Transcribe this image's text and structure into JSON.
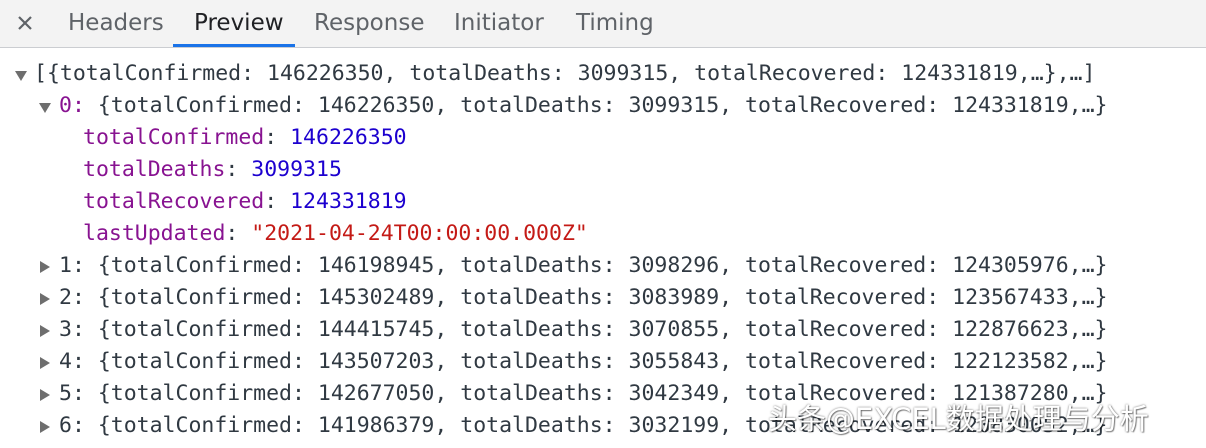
{
  "tabs": {
    "close_icon": "close-icon",
    "items": [
      {
        "label": "Headers"
      },
      {
        "label": "Preview"
      },
      {
        "label": "Response"
      },
      {
        "label": "Initiator"
      },
      {
        "label": "Timing"
      }
    ],
    "active": "Preview",
    "accent_color": "#1a73e8"
  },
  "preview": {
    "root_summary": "[{totalConfirmed: 146226350, totalDeaths: 3099315, totalRecovered: 124331819,…},…]",
    "expanded_item": {
      "index_label": "0:",
      "summary": " {totalConfirmed: 146226350, totalDeaths: 3099315, totalRecovered: 124331819,…}",
      "props": [
        {
          "key": "totalConfirmed",
          "sep": ": ",
          "value": "146226350",
          "type": "num"
        },
        {
          "key": "totalDeaths",
          "sep": ": ",
          "value": "3099315",
          "type": "num"
        },
        {
          "key": "totalRecovered",
          "sep": ": ",
          "value": "124331819",
          "type": "num"
        },
        {
          "key": "lastUpdated",
          "sep": ": ",
          "value": "\"2021-04-24T00:00:00.000Z\"",
          "type": "str"
        }
      ]
    },
    "collapsed_items": [
      {
        "label": "1: {totalConfirmed: 146198945, totalDeaths: 3098296, totalRecovered: 124305976,…}"
      },
      {
        "label": "2: {totalConfirmed: 145302489, totalDeaths: 3083989, totalRecovered: 123567433,…}"
      },
      {
        "label": "3: {totalConfirmed: 144415745, totalDeaths: 3070855, totalRecovered: 122876623,…}"
      },
      {
        "label": "4: {totalConfirmed: 143507203, totalDeaths: 3055843, totalRecovered: 122123582,…}"
      },
      {
        "label": "5: {totalConfirmed: 142677050, totalDeaths: 3042349, totalRecovered: 121387280,…}"
      },
      {
        "label": "6: {totalConfirmed: 141986379, totalDeaths: 3032199, totalRecovered: 120830052,…}"
      }
    ],
    "colors": {
      "key": "#881391",
      "number": "#1c00cf",
      "string": "#c41a16",
      "text": "#303942"
    }
  },
  "watermark": "头条@EXCEL数据处理与分析"
}
